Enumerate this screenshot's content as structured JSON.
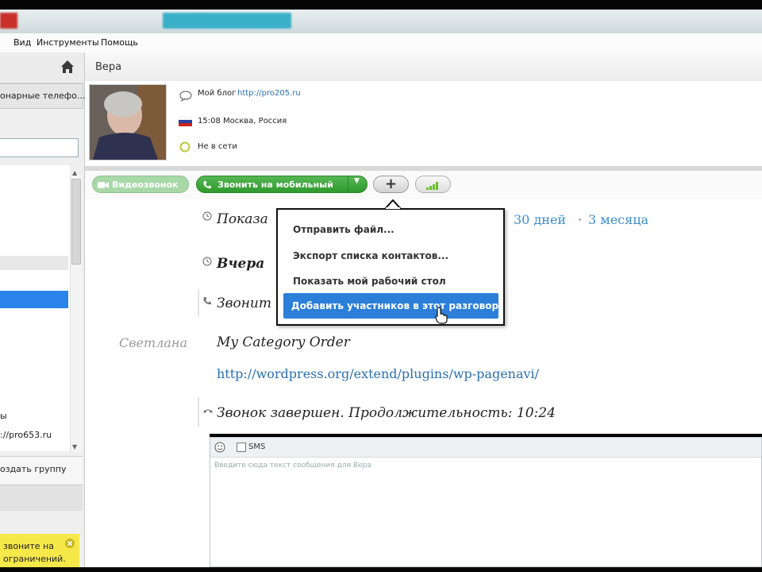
{
  "menubar": {
    "items": [
      "Вид",
      "Инструменты",
      "Помощь"
    ]
  },
  "sidebar": {
    "phones_label": "онарные телефо...",
    "contact_line1": "ы",
    "contact_line2": "://pro653.ru",
    "create_group": "оздать группу",
    "promo_line1": "звоните на",
    "promo_line2": "ограничений."
  },
  "header": {
    "contact_name": "Вера"
  },
  "profile": {
    "blog_label": "Мой блог",
    "blog_link": "http://pro205.ru",
    "time_location": "15:08 Москва, Россия",
    "status": "Не в сети"
  },
  "toolbar": {
    "video_call": "Видеозвонок",
    "call_mobile": "Звонить на мобильный",
    "plus": "+"
  },
  "chat": {
    "show_label": "Показа",
    "period_30": "30 дней",
    "period_sep": "·",
    "period_3m": "3 месяца",
    "yesterday": "Вчера",
    "call_label": "Звонит",
    "sender": "Светлана",
    "message_title": "My Category Order",
    "message_link": "http://wordpress.org/extend/plugins/wp-pagenavi/",
    "call_ended": "Звонок завершен. Продолжительность: 10:24"
  },
  "input": {
    "sms_label": "SMS",
    "placeholder": "Введите сюда текст сообщения для Вера"
  },
  "popup_menu": {
    "items": [
      "Отправить файл...",
      "Экспорт списка контактов...",
      "Показать мой рабочий стол",
      "Добавить участников в этот разговор"
    ],
    "highlighted_index": 3
  },
  "colors": {
    "accent_green": "#2f9a2d",
    "highlight_blue": "#2b7fd9",
    "link_blue": "#2a6fb0"
  }
}
